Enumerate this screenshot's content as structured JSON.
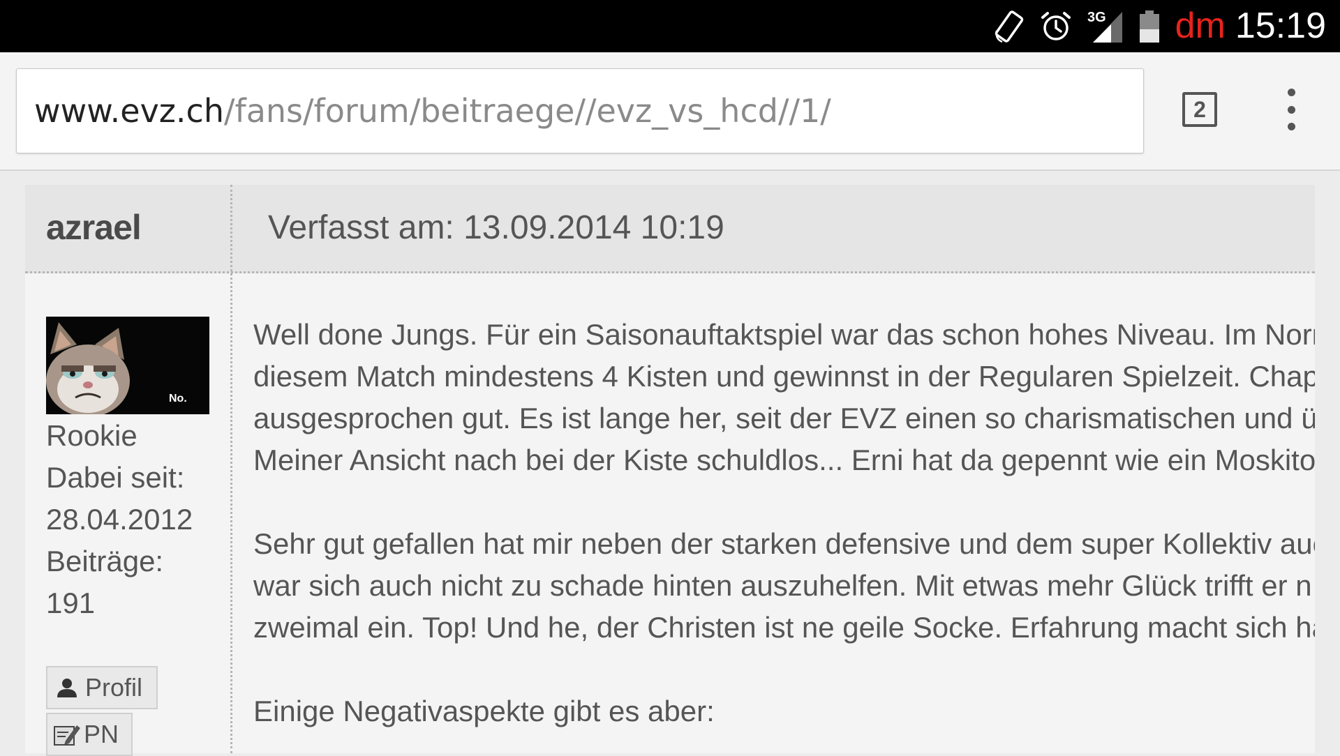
{
  "status_bar": {
    "carrier": "dm",
    "time": "15:19",
    "network": "3G",
    "icons": [
      "screen-rotation-icon",
      "alarm-icon",
      "signal-3g-icon",
      "battery-icon"
    ]
  },
  "browser": {
    "url_host": "www.evz.ch",
    "url_path": "/fans/forum/beitraege//evz_vs_hcd//1/",
    "tab_count": "2",
    "icons": [
      "tabs-icon",
      "overflow-menu-icon"
    ]
  },
  "post": {
    "author": "azrael",
    "date_label": "Verfasst am: 13.09.2014 10:19",
    "avatar_text": "No.",
    "user_info": {
      "rank": "Rookie",
      "joined_label": "Dabei seit:",
      "joined_date": "28.04.2012",
      "posts_label": "Beiträge:",
      "posts_count": "191"
    },
    "buttons": {
      "profile": "Profil",
      "pm": "PN"
    },
    "paragraphs": [
      [
        "Well done Jungs. Für ein Saisonauftaktspiel war das schon hohes Niveau. Im Norn",
        "diesem Match mindestens 4 Kisten und gewinnst in der Regularen Spielzeit. Chape",
        "ausgesprochen gut. Es ist lange her, seit der EVZ einen so charismatischen und üb",
        "Meiner Ansicht nach bei der Kiste schuldlos... Erni hat da gepennt wie ein Moskito"
      ],
      [
        "Sehr gut gefallen hat mir neben der starken defensive und dem super Kollektiv auc",
        "war sich auch nicht zu schade hinten auszuhelfen. Mit etwas mehr Glück trifft er n",
        "zweimal ein. Top! Und he, der Christen ist ne geile Socke. Erfahrung macht sich ha"
      ],
      [
        "Einige Negativaspekte gibt es aber:"
      ]
    ]
  },
  "colors": {
    "status_bar_bg": "#000000",
    "carrier_red": "#e8231c",
    "post_header_bg": "#e5e5e5",
    "post_bg": "#f4f4f4",
    "text_gray": "#555555"
  }
}
